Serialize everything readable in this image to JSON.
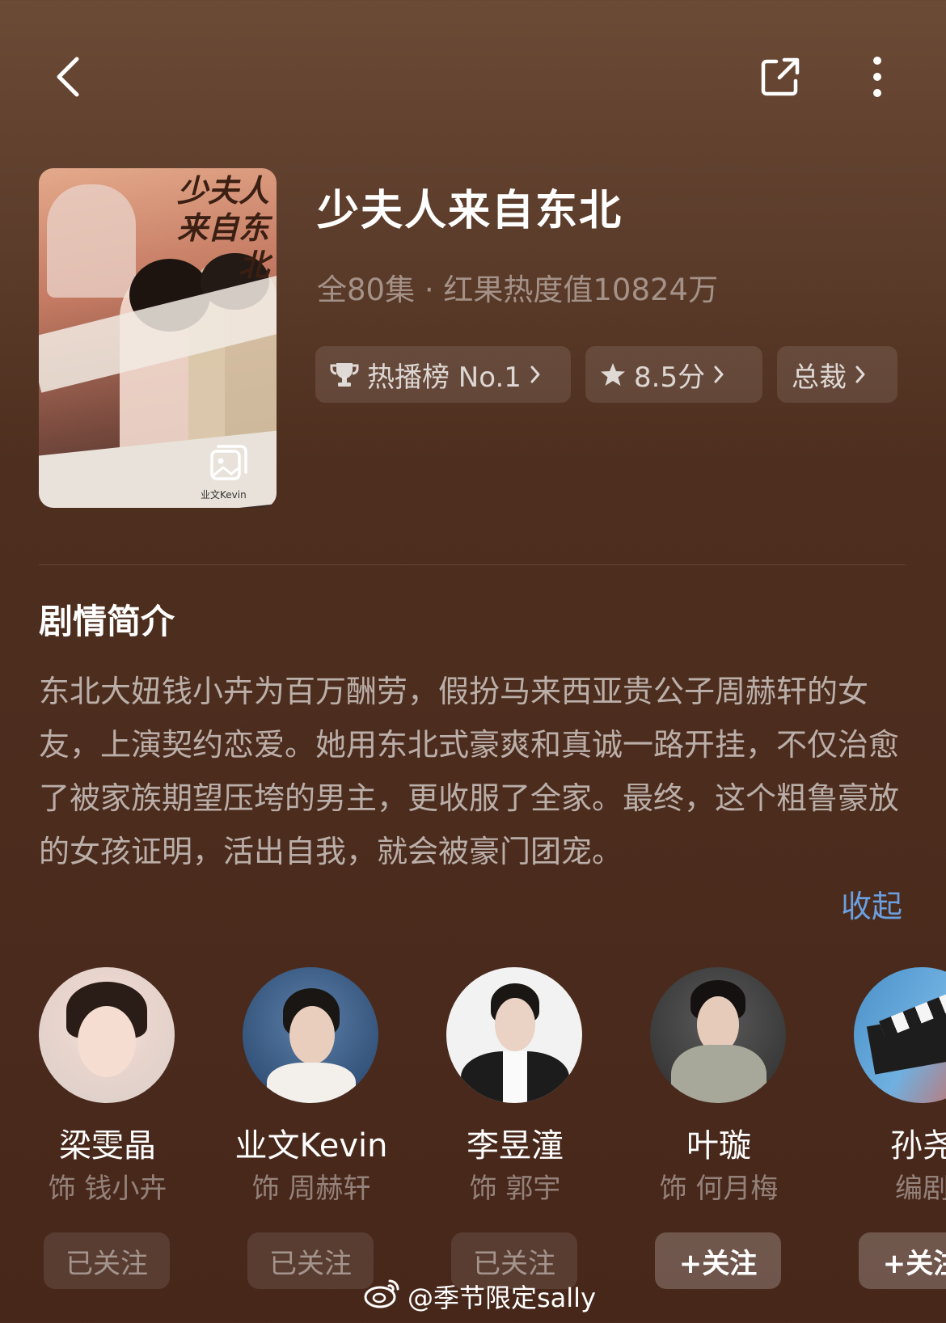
{
  "show": {
    "title": "少夫人来自东北",
    "meta": "全80集 · 红果热度值10824万",
    "poster": {
      "title_line1": "少夫人",
      "title_line2": "来自东北",
      "credit": "业文Kevin"
    }
  },
  "chips": [
    {
      "label": "热播榜 No.1",
      "icon": "trophy-icon"
    },
    {
      "label": "8.5分",
      "icon": "star-icon"
    },
    {
      "label": "总裁",
      "icon": ""
    }
  ],
  "synopsis": {
    "heading": "剧情简介",
    "text": "东北大妞钱小卉为百万酬劳，假扮马来西亚贵公子周赫轩的女友，上演契约恋爱。她用东北式豪爽和真诚一路开挂，不仅治愈了被家族期望压垮的男主，更收服了全家。最终，这个粗鲁豪放的女孩证明，活出自我，就会被豪门团宠。",
    "collapse_label": "收起"
  },
  "cast": [
    {
      "name": "梁雯晶",
      "role": "饰 钱小卉",
      "follow": "已关注",
      "followed": true
    },
    {
      "name": "业文Kevin",
      "role": "饰 周赫轩",
      "follow": "已关注",
      "followed": true
    },
    {
      "name": "李昱潼",
      "role": "饰 郭宇",
      "follow": "已关注",
      "followed": true
    },
    {
      "name": "叶璇",
      "role": "饰 何月梅",
      "follow": "+关注",
      "followed": false
    },
    {
      "name": "孙尧",
      "role": "编剧",
      "follow": "+关注",
      "followed": false
    }
  ],
  "watermark": "@季节限定sally"
}
